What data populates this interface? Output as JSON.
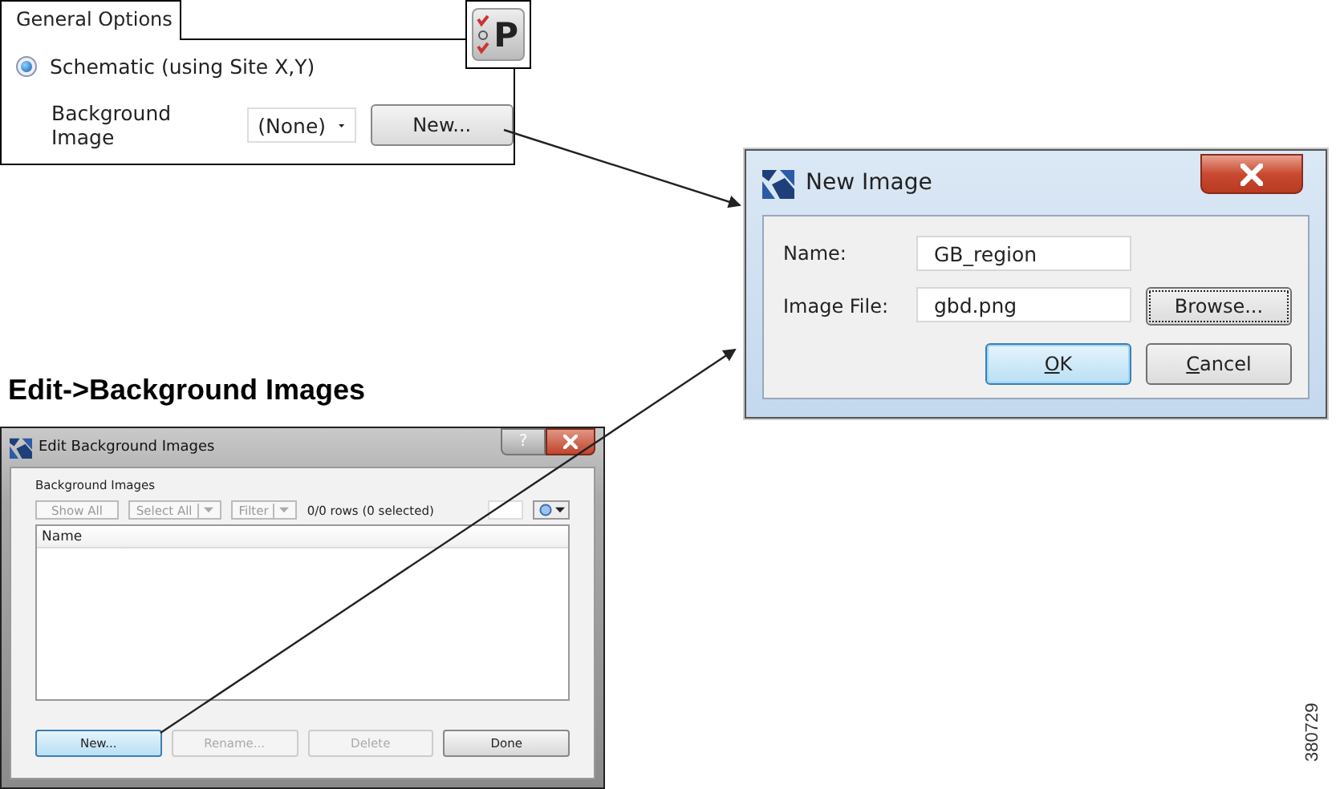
{
  "general_options": {
    "tab": "General Options",
    "icon_letter": "P",
    "radio": {
      "label": "Schematic (using Site X,Y)",
      "selected": true
    },
    "background_label": "Background Image",
    "background_value": "(None)",
    "new_button": "New..."
  },
  "new_image_dialog": {
    "title": "New Image",
    "fields": [
      {
        "label": "Name:",
        "value": "GB_region"
      },
      {
        "label": "Image File:",
        "value": "gbd.png"
      }
    ],
    "browse_button": {
      "label": "Browse...",
      "focused": true
    },
    "buttons": [
      {
        "label": "OK",
        "default": true,
        "underline_first": true
      },
      {
        "label": "Cancel",
        "default": false,
        "underline_first": true
      }
    ]
  },
  "caption": "Edit->Background Images",
  "edit_dialog": {
    "title": "Edit Background Images",
    "help_glyph": "?",
    "group_label": "Background Images",
    "toolbar": [
      {
        "label": "Show All",
        "kind": "button",
        "disabled": true
      },
      {
        "label": "Select All",
        "kind": "dropdown",
        "disabled": true
      },
      {
        "label": "Filter",
        "kind": "dropdown",
        "disabled": true
      }
    ],
    "row_count": "0/0 rows (0 selected)",
    "column": "Name",
    "buttons": [
      {
        "label": "New...",
        "disabled": false,
        "default": true
      },
      {
        "label": "Rename...",
        "disabled": true,
        "default": false
      },
      {
        "label": "Delete",
        "disabled": true,
        "default": false
      },
      {
        "label": "Done",
        "disabled": false,
        "default": false
      }
    ]
  },
  "figure_number": "380729"
}
